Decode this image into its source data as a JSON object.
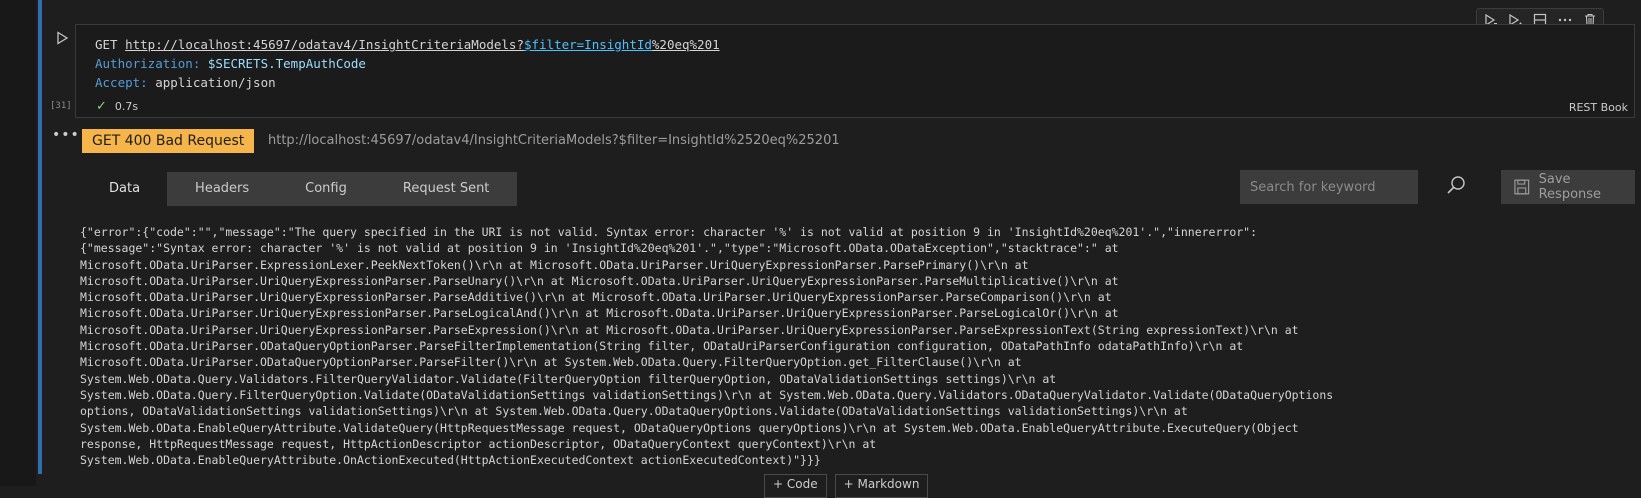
{
  "cell": {
    "execution_count": "[31]",
    "request": {
      "method": "GET",
      "url_base": "http://localhost:45697/odatav4/InsightCriteriaModels?",
      "url_query": "$filter=InsightId",
      "url_rest": "%20eq%201",
      "headers": [
        {
          "key": "Authorization:",
          "value": "$SECRETS.TempAuthCode"
        },
        {
          "key": "Accept:",
          "value": "application/json"
        }
      ]
    },
    "duration": "0.7s",
    "language": "REST Book"
  },
  "toolbar": {
    "icons": [
      "run-by-line-icon",
      "execute-above-icon",
      "split-cell-icon",
      "more-icon",
      "delete-icon"
    ]
  },
  "output": {
    "status_badge": "GET 400 Bad Request",
    "status_color": "#f5b54a",
    "request_url": "http://localhost:45697/odatav4/InsightCriteriaModels?$filter=InsightId%2520eq%25201",
    "tabs": [
      "Data",
      "Headers",
      "Config",
      "Request Sent"
    ],
    "active_tab": "Data",
    "search": {
      "placeholder": "Search for keyword"
    },
    "save_label": "Save Response",
    "body_lines": [
      "{\"error\":{\"code\":\"\",\"message\":\"The query specified in the URI is not valid. Syntax error: character '%' is not valid at position 9 in 'InsightId%20eq%201'.\",\"innererror\":",
      "{\"message\":\"Syntax error: character '%' is not valid at position 9 in 'InsightId%20eq%201'.\",\"type\":\"Microsoft.OData.ODataException\",\"stacktrace\":\" at",
      "Microsoft.OData.UriParser.ExpressionLexer.PeekNextToken()\\r\\n at Microsoft.OData.UriParser.UriQueryExpressionParser.ParsePrimary()\\r\\n at",
      "Microsoft.OData.UriParser.UriQueryExpressionParser.ParseUnary()\\r\\n at Microsoft.OData.UriParser.UriQueryExpressionParser.ParseMultiplicative()\\r\\n at",
      "Microsoft.OData.UriParser.UriQueryExpressionParser.ParseAdditive()\\r\\n at Microsoft.OData.UriParser.UriQueryExpressionParser.ParseComparison()\\r\\n at",
      "Microsoft.OData.UriParser.UriQueryExpressionParser.ParseLogicalAnd()\\r\\n at Microsoft.OData.UriParser.UriQueryExpressionParser.ParseLogicalOr()\\r\\n at",
      "Microsoft.OData.UriParser.UriQueryExpressionParser.ParseExpression()\\r\\n at Microsoft.OData.UriParser.UriQueryExpressionParser.ParseExpressionText(String expressionText)\\r\\n at",
      "Microsoft.OData.UriParser.ODataQueryOptionParser.ParseFilterImplementation(String filter, ODataUriParserConfiguration configuration, ODataPathInfo odataPathInfo)\\r\\n at",
      "Microsoft.OData.UriParser.ODataQueryOptionParser.ParseFilter()\\r\\n at System.Web.OData.Query.FilterQueryOption.get_FilterClause()\\r\\n at",
      "System.Web.OData.Query.Validators.FilterQueryValidator.Validate(FilterQueryOption filterQueryOption, ODataValidationSettings settings)\\r\\n at",
      "System.Web.OData.Query.FilterQueryOption.Validate(ODataValidationSettings validationSettings)\\r\\n at System.Web.OData.Query.Validators.ODataQueryValidator.Validate(ODataQueryOptions",
      "options, ODataValidationSettings validationSettings)\\r\\n at System.Web.OData.Query.ODataQueryOptions.Validate(ODataValidationSettings validationSettings)\\r\\n at",
      "System.Web.OData.EnableQueryAttribute.ValidateQuery(HttpRequestMessage request, ODataQueryOptions queryOptions)\\r\\n at System.Web.OData.EnableQueryAttribute.ExecuteQuery(Object",
      "response, HttpRequestMessage request, HttpActionDescriptor actionDescriptor, ODataQueryContext queryContext)\\r\\n at",
      "System.Web.OData.EnableQueryAttribute.OnActionExecuted(HttpActionExecutedContext actionExecutedContext)\"}}}"
    ]
  },
  "add_cell": {
    "code_label": "+ Code",
    "markdown_label": "+ Markdown"
  }
}
